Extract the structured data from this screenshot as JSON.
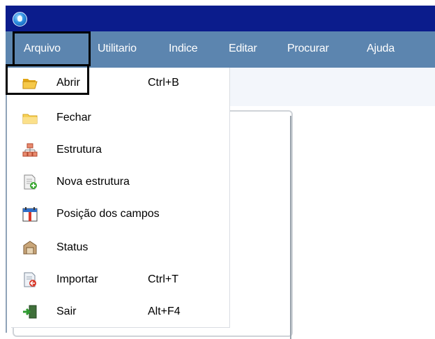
{
  "menubar": {
    "items": [
      {
        "label": "Arquivo",
        "active": true
      },
      {
        "label": "Utilitario"
      },
      {
        "label": "Indice"
      },
      {
        "label": "Editar"
      },
      {
        "label": "Procurar"
      },
      {
        "label": "Ajuda"
      }
    ]
  },
  "dropdown": {
    "items": [
      {
        "label": "Abrir",
        "shortcut": "Ctrl+B",
        "icon": "open-folder-icon"
      },
      {
        "label": "Fechar",
        "shortcut": "",
        "icon": "folder-icon"
      },
      {
        "label": "Estrutura",
        "shortcut": "",
        "icon": "structure-icon"
      },
      {
        "label": "Nova estrutura",
        "shortcut": "",
        "icon": "new-structure-icon"
      },
      {
        "label": "Posição dos campos",
        "shortcut": "",
        "icon": "calendar-icon"
      },
      {
        "label": "Status",
        "shortcut": "",
        "icon": "status-icon"
      },
      {
        "label": "Importar",
        "shortcut": "Ctrl+T",
        "icon": "import-icon"
      },
      {
        "label": "Sair",
        "shortcut": "Alt+F4",
        "icon": "exit-icon"
      }
    ]
  },
  "colors": {
    "titlebar": "#0b1c8c",
    "menubar": "#5c85af"
  }
}
